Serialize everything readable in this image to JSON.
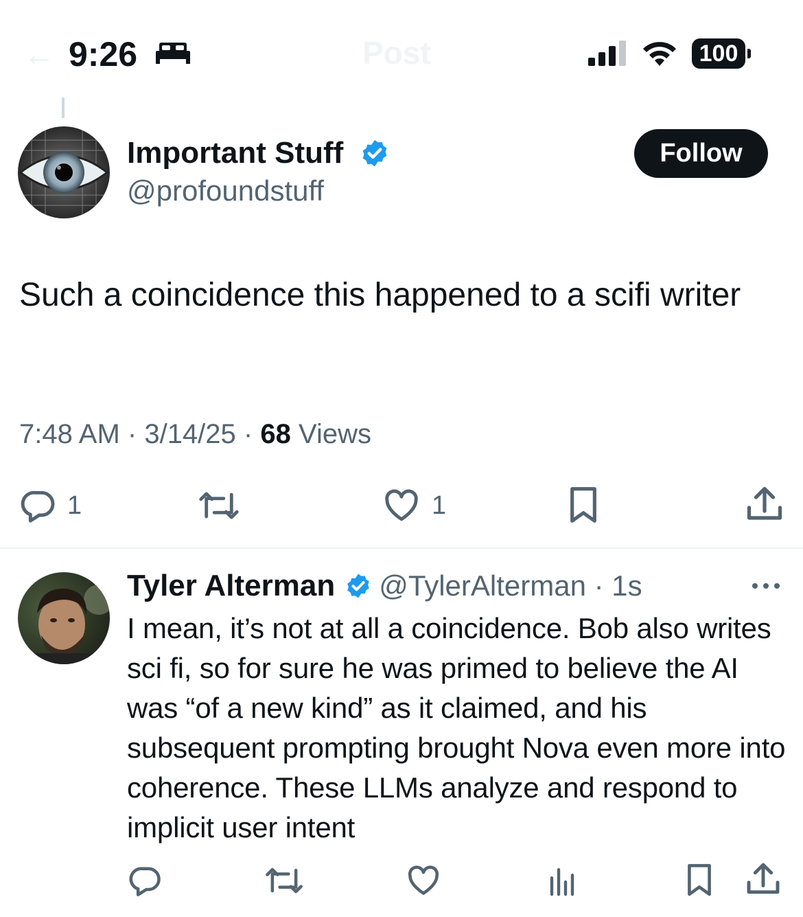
{
  "status_bar": {
    "time": "9:26",
    "battery": "100",
    "icons": [
      "sleep-focus-icon",
      "cellular-signal-icon",
      "wifi-icon",
      "battery-icon"
    ]
  },
  "nav": {
    "title": "Post",
    "back_icon": "back-arrow-icon"
  },
  "main_post": {
    "author_name": "Important Stuff",
    "handle": "@profoundstuff",
    "verified": true,
    "follow_label": "Follow",
    "text": "Such a coincidence this happened to a scifi writer",
    "time": "7:48 AM",
    "date": "3/14/25",
    "views_count": "68",
    "views_label": "Views",
    "reply_count": "1",
    "like_count": "1",
    "icons": [
      "reply-icon",
      "repost-icon",
      "like-icon",
      "bookmark-icon",
      "share-icon"
    ]
  },
  "reply_post": {
    "author_name": "Tyler Alterman",
    "handle": "@TylerAlterman",
    "age": "1s",
    "verified": true,
    "text": "I mean, it’s not at all a coincidence. Bob also writes sci fi, so for sure he was primed to believe the AI was “of a new kind” as it claimed, and his subsequent prompting brought Nova even more into coherence. These LLMs analyze and respond to implicit user intent",
    "icons": [
      "reply-icon",
      "repost-icon",
      "like-icon",
      "views-icon",
      "bookmark-icon",
      "share-icon",
      "more-icon"
    ]
  },
  "colors": {
    "text": "#0f1419",
    "secondary": "#536471",
    "verified": "#1d9bf0",
    "follow_bg": "#0f1419"
  }
}
